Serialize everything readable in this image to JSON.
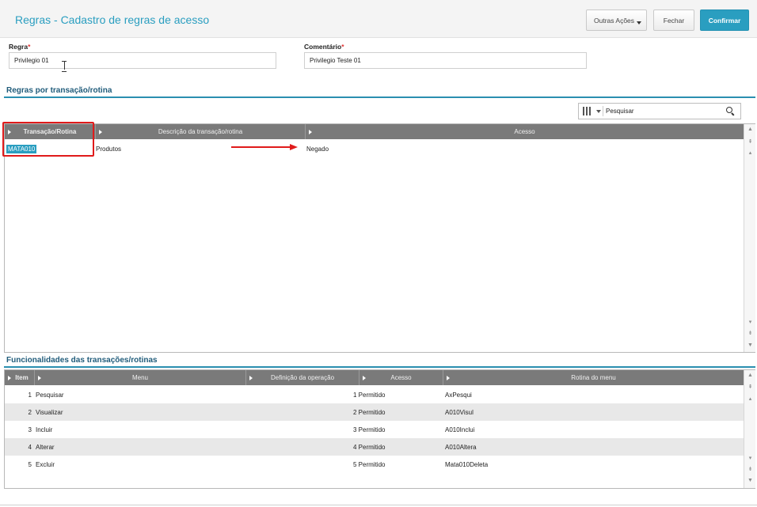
{
  "header": {
    "title": "Regras - Cadastro de regras de acesso",
    "buttons": {
      "outras_acoes": "Outras Ações",
      "fechar": "Fechar",
      "confirmar": "Confirmar"
    }
  },
  "form": {
    "regra": {
      "label": "Regra",
      "required_mark": "*",
      "value": "Privilegio 01"
    },
    "comentario": {
      "label": "Comentário",
      "required_mark": "*",
      "value": "Privilegio Teste 01"
    }
  },
  "rules_section": {
    "title": "Regras por transação/rotina",
    "search_placeholder": "Pesquisar",
    "columns": [
      "Transação/Rotina",
      "Descrição da transação/rotina",
      "Acesso"
    ],
    "rows": [
      {
        "transacao": "MATA010",
        "descricao": "Produtos",
        "acesso": "Negado"
      }
    ]
  },
  "functions_section": {
    "title": "Funcionalidades das transações/rotinas",
    "columns": [
      "Item",
      "Menu",
      "Definição da operação",
      "Acesso",
      "Rotina do menu"
    ],
    "rows": [
      {
        "item": "1",
        "menu": "Pesquisar",
        "acesso": "1 Permitido",
        "rotina": "AxPesqui"
      },
      {
        "item": "2",
        "menu": "Visualizar",
        "acesso": "2 Permitido",
        "rotina": "A010Visul"
      },
      {
        "item": "3",
        "menu": "Incluir",
        "acesso": "3 Permitido",
        "rotina": "A010Inclui"
      },
      {
        "item": "4",
        "menu": "Alterar",
        "acesso": "4 Permitido",
        "rotina": "A010Altera"
      },
      {
        "item": "5",
        "menu": "Excluir",
        "acesso": "5 Permitido",
        "rotina": "Mata010Deleta"
      }
    ]
  },
  "colors": {
    "accent": "#2a9ec0",
    "highlight": "#e01b1b",
    "grid_header": "#7a7a7a"
  },
  "icons": {
    "search": "magnifier-icon",
    "columns": "columns-icon",
    "sort": "sort-triangle-icon"
  }
}
